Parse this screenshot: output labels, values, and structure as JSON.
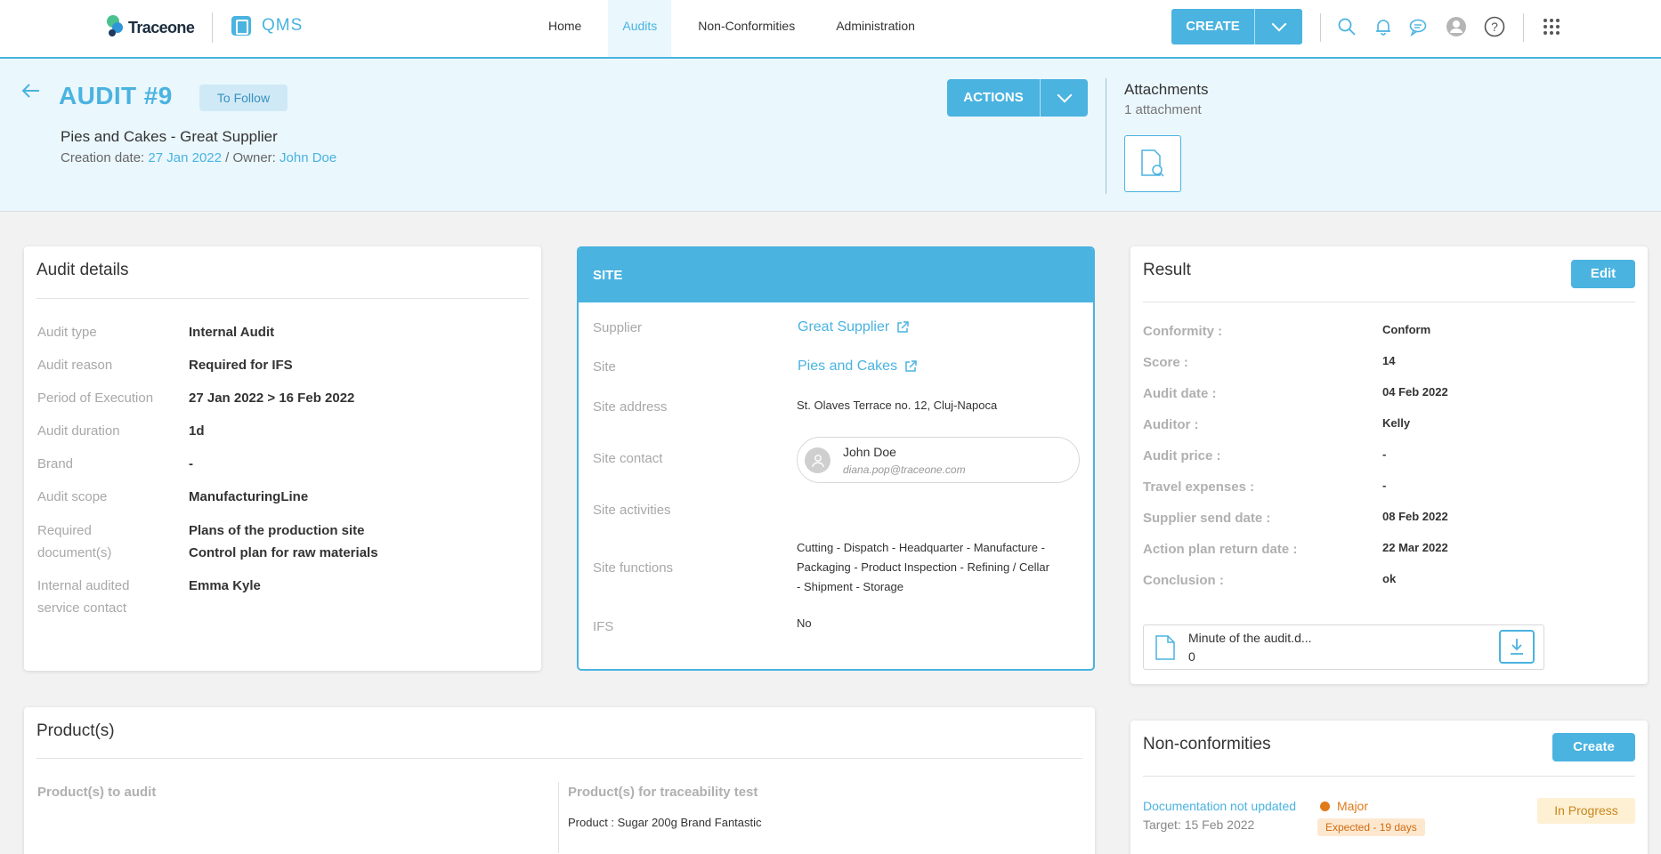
{
  "topbar": {
    "brand": "Traceone",
    "app_name": "QMS",
    "nav": [
      "Home",
      "Audits",
      "Non-Conformities",
      "Administration"
    ],
    "active_nav": "Audits",
    "create_label": "CREATE",
    "icons": [
      "search-icon",
      "bell-icon",
      "chat-icon",
      "user-icon",
      "help-icon",
      "apps-grid-icon"
    ]
  },
  "header": {
    "title": "AUDIT #9",
    "status_badge": "To Follow",
    "subtitle": "Pies and Cakes - Great Supplier",
    "creation_label": "Creation date:",
    "creation_date": "27 Jan 2022",
    "owner_label": "/ Owner:",
    "owner": "John Doe",
    "actions_label": "ACTIONS",
    "attachments_title": "Attachments",
    "attachments_count": "1 attachment"
  },
  "audit_details": {
    "title": "Audit details",
    "rows": [
      {
        "label": "Audit type",
        "value": "Internal Audit"
      },
      {
        "label": "Audit reason",
        "value": "Required for IFS"
      },
      {
        "label": "Period of Execution",
        "value": "27 Jan 2022 > 16 Feb 2022"
      },
      {
        "label": "Audit duration",
        "value": "1d"
      },
      {
        "label": "Brand",
        "value": "-"
      },
      {
        "label": "Audit scope",
        "value": "ManufacturingLine"
      }
    ],
    "required_docs_label_1": "Required",
    "required_docs_label_2": "document(s)",
    "required_docs": [
      "Plans of the production site",
      "Control plan for raw materials"
    ],
    "contact_label_1": "Internal audited",
    "contact_label_2": "service contact",
    "contact_value": "Emma Kyle"
  },
  "site": {
    "header": "SITE",
    "supplier_label": "Supplier",
    "supplier": "Great Supplier",
    "site_label": "Site",
    "site": "Pies and Cakes",
    "address_label": "Site address",
    "address": "St. Olaves Terrace no. 12, Cluj-Napoca",
    "contact_label": "Site contact",
    "contact_name": "John Doe",
    "contact_email": "diana.pop@traceone.com",
    "activities_label": "Site activities",
    "functions_label": "Site functions",
    "functions_lines": [
      "Cutting - Dispatch - Headquarter - Manufacture -",
      "Packaging - Product Inspection - Refining / Cellar",
      "- Shipment - Storage"
    ],
    "ifs_label": "IFS",
    "ifs": "No"
  },
  "result": {
    "title": "Result",
    "edit_label": "Edit",
    "rows": [
      {
        "label": "Conformity :",
        "value": "Conform"
      },
      {
        "label": "Score :",
        "value": "14"
      },
      {
        "label": "Audit date :",
        "value": "04 Feb 2022"
      },
      {
        "label": "Auditor :",
        "value": "Kelly"
      },
      {
        "label": "Audit price :",
        "value": "-"
      },
      {
        "label": "Travel expenses :",
        "value": "-"
      },
      {
        "label": "Supplier send date :",
        "value": "08 Feb 2022"
      },
      {
        "label": "Action plan return date :",
        "value": "22 Mar 2022"
      },
      {
        "label": "Conclusion :",
        "value": "ok"
      }
    ],
    "file_name": "Minute of the audit.d...",
    "file_size": "0"
  },
  "products": {
    "title": "Product(s)",
    "to_audit_label": "Product(s) to audit",
    "traceability_label": "Product(s) for traceability test",
    "traceability_item": "Product : Sugar 200g Brand Fantastic"
  },
  "non_conformities": {
    "title": "Non-conformities",
    "create_label": "Create",
    "item": {
      "name": "Documentation not updated",
      "target": "Target: 15 Feb 2022",
      "severity": "Major",
      "expected": "Expected - 19 days",
      "status": "In Progress"
    }
  },
  "colors": {
    "accent": "#4ab3e0",
    "major": "#e07b1a",
    "header_bg": "#eaf7fd"
  }
}
